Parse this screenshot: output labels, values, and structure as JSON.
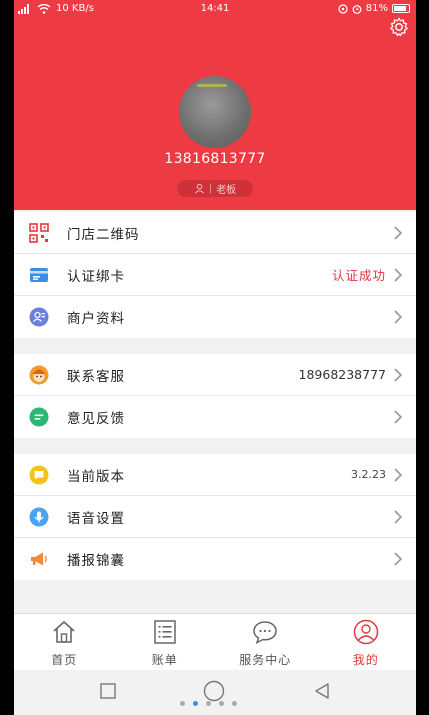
{
  "status_bar": {
    "speed": "10 KB/s",
    "time": "14:41",
    "battery": "81%"
  },
  "profile": {
    "phone": "13816813777",
    "role": "老板"
  },
  "groups": [
    {
      "rows": [
        {
          "label": "门店二维码",
          "value": "",
          "icon": "qr-code-icon",
          "color": "#e0383e"
        },
        {
          "label": "认证绑卡",
          "value": "认证成功",
          "icon": "card-icon",
          "color": "#3a8ee6"
        },
        {
          "label": "商户资料",
          "value": "",
          "icon": "merchant-icon",
          "color": "#6b7fe0"
        }
      ]
    },
    {
      "rows": [
        {
          "label": "联系客服",
          "value": "18968238777",
          "icon": "customer-service-icon",
          "color": "#f39a2e"
        },
        {
          "label": "意见反馈",
          "value": "",
          "icon": "feedback-icon",
          "color": "#2bb673"
        }
      ]
    },
    {
      "rows": [
        {
          "label": "当前版本",
          "value": "3.2.23",
          "icon": "version-icon",
          "color": "#f5c21b"
        },
        {
          "label": "语音设置",
          "value": "",
          "icon": "microphone-icon",
          "color": "#4aa3f0"
        },
        {
          "label": "播报锦囊",
          "value": "",
          "icon": "megaphone-icon",
          "color": "#f08a3a"
        }
      ]
    }
  ],
  "tabs": [
    {
      "label": "首页",
      "icon": "home-icon"
    },
    {
      "label": "账单",
      "icon": "bill-list-icon"
    },
    {
      "label": "服务中心",
      "icon": "chat-bubble-icon"
    },
    {
      "label": "我的",
      "icon": "user-profile-icon",
      "active": true
    }
  ],
  "colors": {
    "accent": "#ee3b43",
    "background": "#f2f2f2"
  }
}
